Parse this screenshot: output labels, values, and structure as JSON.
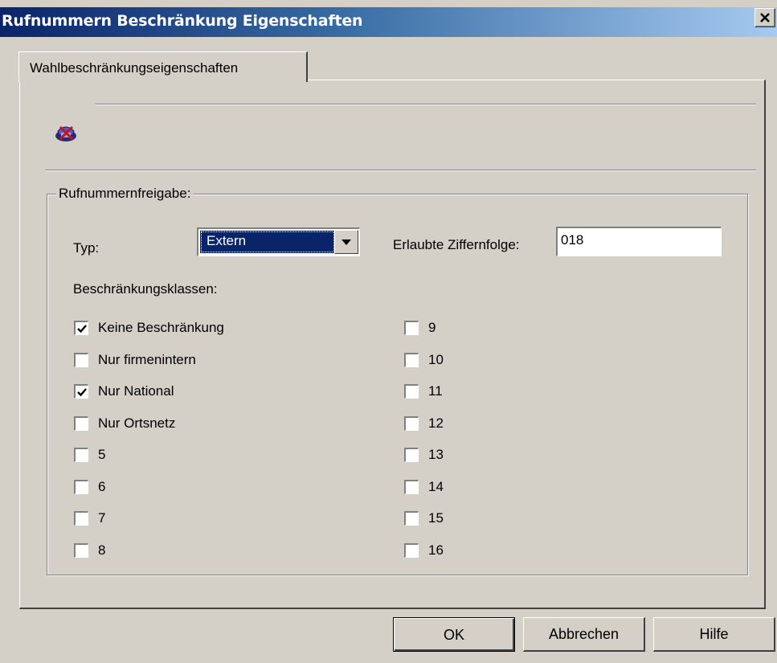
{
  "window": {
    "title": "Rufnummern Beschränkung Eigenschaften",
    "close_glyph": "✕"
  },
  "tabs": [
    {
      "label": "Wahlbeschränkungseigenschaften",
      "selected": true
    }
  ],
  "header_icon": "phone-restriction-icon",
  "group": {
    "label": "Rufnummernfreigabe:",
    "type_label": "Typ:",
    "type_value": "Extern",
    "digits_label": "Erlaubte Ziffernfolge:",
    "digits_value": "018",
    "classes_label": "Beschränkungsklassen:"
  },
  "classes_left": [
    {
      "label": "Keine Beschränkung",
      "checked": true
    },
    {
      "label": "Nur firmenintern",
      "checked": false
    },
    {
      "label": "Nur National",
      "checked": true
    },
    {
      "label": "Nur Ortsnetz",
      "checked": false
    },
    {
      "label": "5",
      "checked": false
    },
    {
      "label": "6",
      "checked": false
    },
    {
      "label": "7",
      "checked": false
    },
    {
      "label": "8",
      "checked": false
    }
  ],
  "classes_right": [
    {
      "label": "9",
      "checked": false
    },
    {
      "label": "10",
      "checked": false
    },
    {
      "label": "11",
      "checked": false
    },
    {
      "label": "12",
      "checked": false
    },
    {
      "label": "13",
      "checked": false
    },
    {
      "label": "14",
      "checked": false
    },
    {
      "label": "15",
      "checked": false
    },
    {
      "label": "16",
      "checked": false
    }
  ],
  "buttons": {
    "ok": "OK",
    "cancel": "Abbrechen",
    "help": "Hilfe"
  },
  "colors": {
    "titlebar_start": "#0a246a",
    "titlebar_end": "#a6caf0",
    "face": "#d4d0c8",
    "selection": "#0a246a"
  }
}
